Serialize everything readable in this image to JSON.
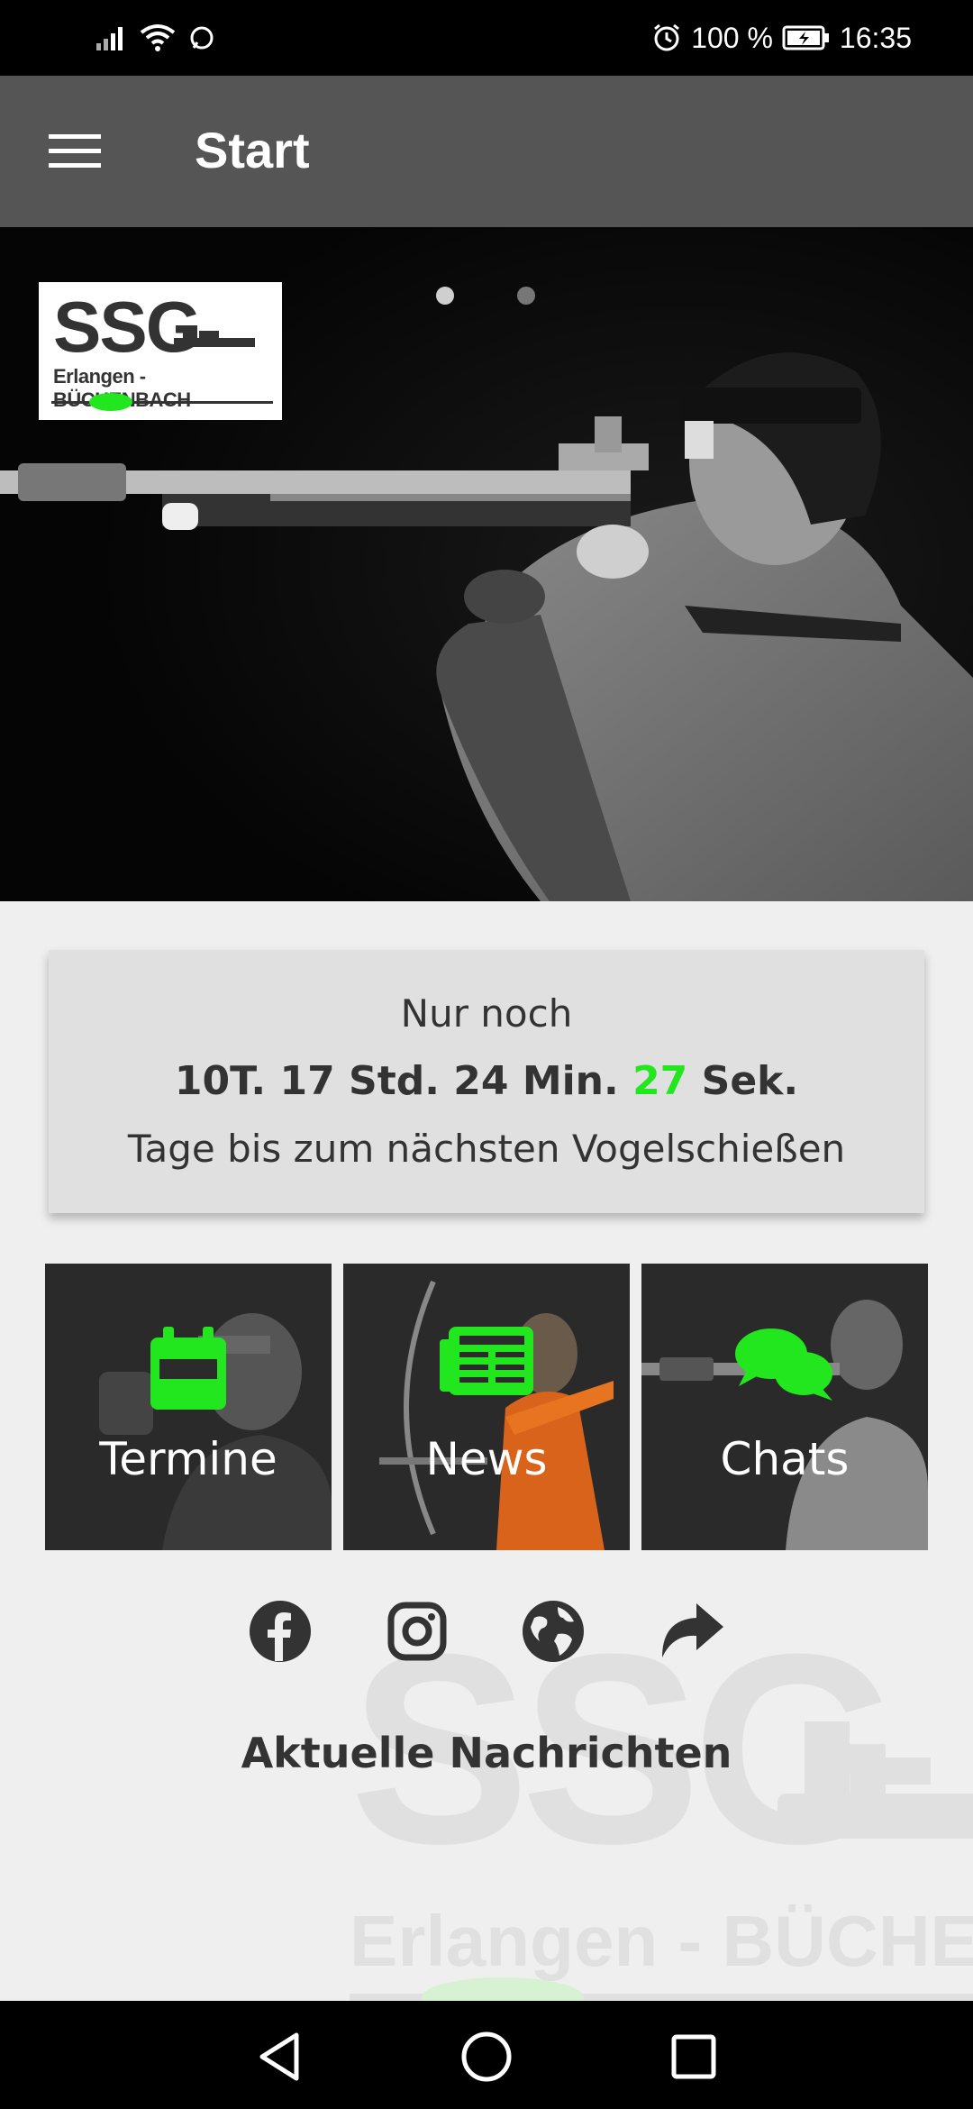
{
  "status_bar": {
    "battery": "100 %",
    "time": "16:35"
  },
  "app_bar": {
    "title": "Start"
  },
  "hero": {
    "logo_text": "SSG",
    "logo_subtext": "Erlangen - BÜCHENBACH",
    "slide_count": 2,
    "active_slide": 1
  },
  "countdown": {
    "line1": "Nur noch",
    "days": "10T.",
    "hours": "17 Std.",
    "minutes": "24 Min.",
    "seconds": "27",
    "seconds_unit": "Sek.",
    "line3": "Tage bis zum nächsten Vogelschießen"
  },
  "tiles": [
    {
      "label": "Termine",
      "icon": "calendar-icon"
    },
    {
      "label": "News",
      "icon": "newspaper-icon"
    },
    {
      "label": "Chats",
      "icon": "chat-bubbles-icon"
    }
  ],
  "social": [
    "facebook-icon",
    "instagram-icon",
    "globe-icon",
    "share-icon"
  ],
  "news_heading": "Aktuelle Nachrichten",
  "watermark": {
    "ssg": "SSG",
    "sub": "Erlangen - BÜCHENBAC"
  },
  "colors": {
    "accent_green": "#22e61e",
    "app_bar": "#555555",
    "background": "#efefef"
  }
}
